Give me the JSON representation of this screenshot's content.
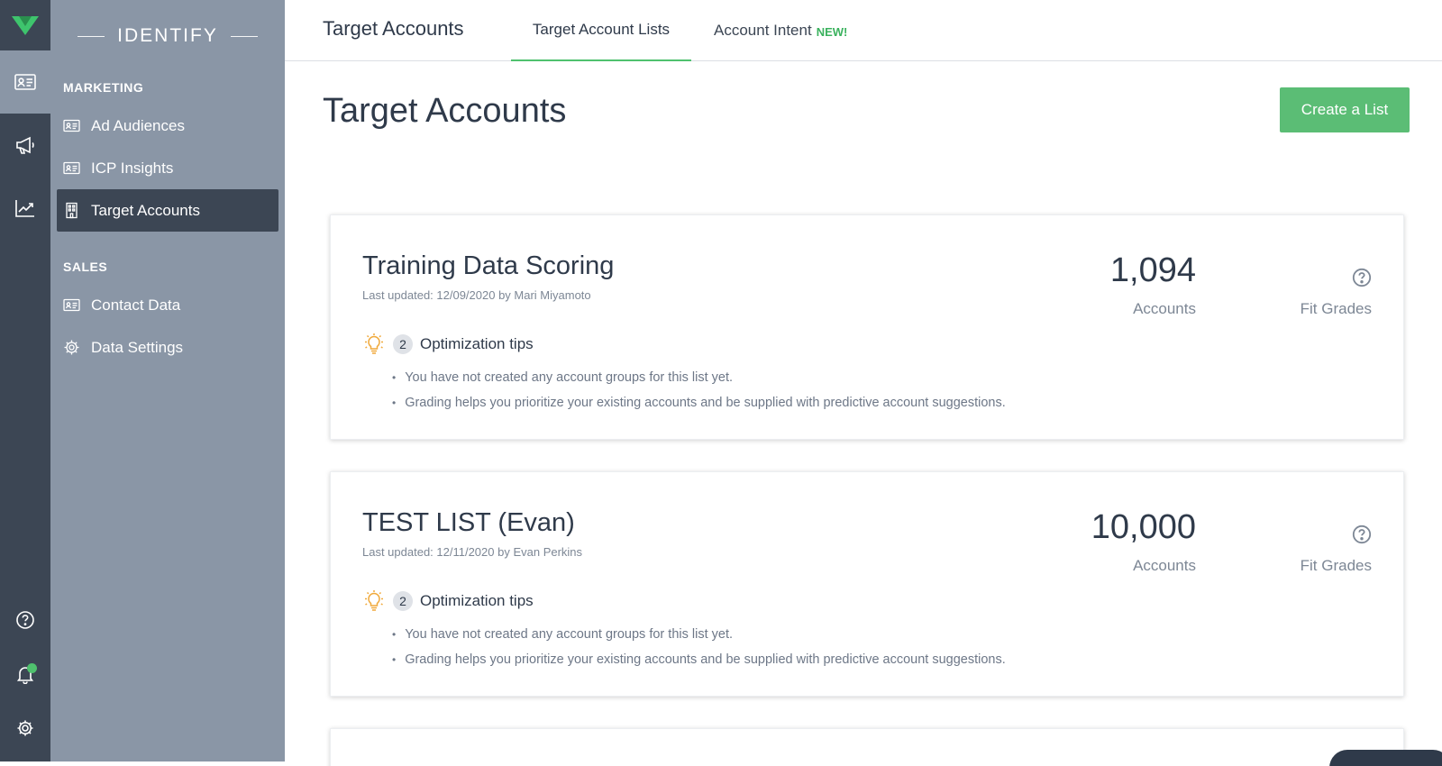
{
  "rail": {
    "items": [
      {
        "name": "identify-icon",
        "active": true
      },
      {
        "name": "megaphone-icon",
        "active": false
      },
      {
        "name": "analytics-chart-icon",
        "active": false
      }
    ],
    "bottom": [
      "help-icon",
      "notifications-bell-icon",
      "settings-gear-icon"
    ],
    "notification_dot_color": "#4fc16e"
  },
  "sidebar": {
    "title": "IDENTIFY",
    "marketing_label": "MARKETING",
    "sales_label": "SALES",
    "marketing_items": [
      {
        "label": "Ad Audiences",
        "icon": "id-card-icon"
      },
      {
        "label": "ICP Insights",
        "icon": "id-card-icon"
      },
      {
        "label": "Target Accounts",
        "icon": "building-icon"
      }
    ],
    "sales_items": [
      {
        "label": "Contact Data",
        "icon": "id-card-icon"
      },
      {
        "label": "Data Settings",
        "icon": "gear-icon"
      }
    ]
  },
  "header": {
    "title": "Target Accounts",
    "tabs": [
      {
        "label": "Target Account Lists",
        "active": true
      },
      {
        "label": "Account Intent",
        "badge": "NEW!",
        "active": false
      }
    ]
  },
  "main": {
    "title": "Target Accounts",
    "create_button": "Create a List"
  },
  "lists": [
    {
      "name": "Training Data Scoring",
      "updated": "Last updated: 12/09/2020 by Mari Miyamoto",
      "accounts_value": "1,094",
      "accounts_label": "Accounts",
      "fit_label": "Fit Grades",
      "tips_count": "2",
      "tips_label": "Optimization tips",
      "tips": [
        "You have not created any account groups for this list yet.",
        "Grading helps you prioritize your existing accounts and be supplied with predictive account suggestions."
      ]
    },
    {
      "name": "TEST LIST (Evan)",
      "updated": "Last updated: 12/11/2020 by Evan Perkins",
      "accounts_value": "10,000",
      "accounts_label": "Accounts",
      "fit_label": "Fit Grades",
      "tips_count": "2",
      "tips_label": "Optimization tips",
      "tips": [
        "You have not created any account groups for this list yet.",
        "Grading helps you prioritize your existing accounts and be supplied with predictive account suggestions."
      ]
    }
  ],
  "colors": {
    "rail_bg": "#3c4654",
    "sidebar_bg": "#8a96a6",
    "accent_green": "#5bbd75",
    "tip_bulb": "#f0a93b"
  }
}
